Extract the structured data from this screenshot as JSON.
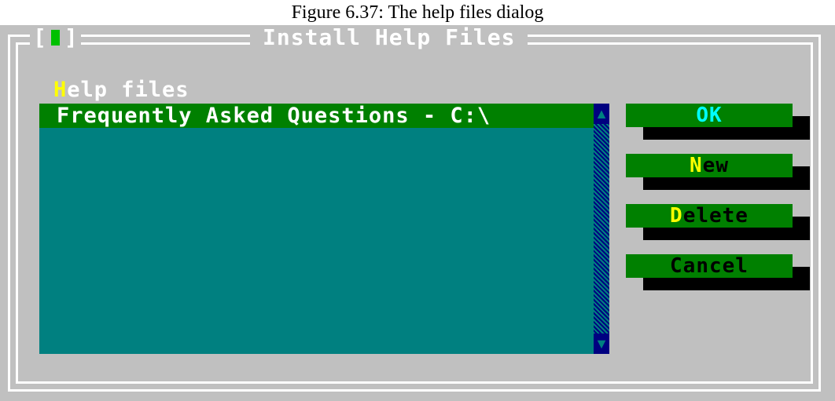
{
  "caption": "Figure 6.37: The help files dialog",
  "window": {
    "close_box_left": "[",
    "close_box_right": "]",
    "title": "Install Help Files"
  },
  "list": {
    "label_hotkey": "H",
    "label_rest": "elp files",
    "items": [
      "Frequently Asked Questions - C:\\"
    ],
    "scroll_up": "▲",
    "scroll_down": "▼"
  },
  "buttons": {
    "ok": "OK",
    "new_hotkey": "N",
    "new_rest": "ew",
    "delete_hotkey": "D",
    "delete_rest": "elete",
    "cancel": "Cancel"
  },
  "colors": {
    "dialog_bg": "#c0c0c0",
    "list_bg": "#008080",
    "selection_bg": "#008000",
    "button_bg": "#008000",
    "hotkey": "#ffff00",
    "default_button_text": "#00ffff"
  }
}
